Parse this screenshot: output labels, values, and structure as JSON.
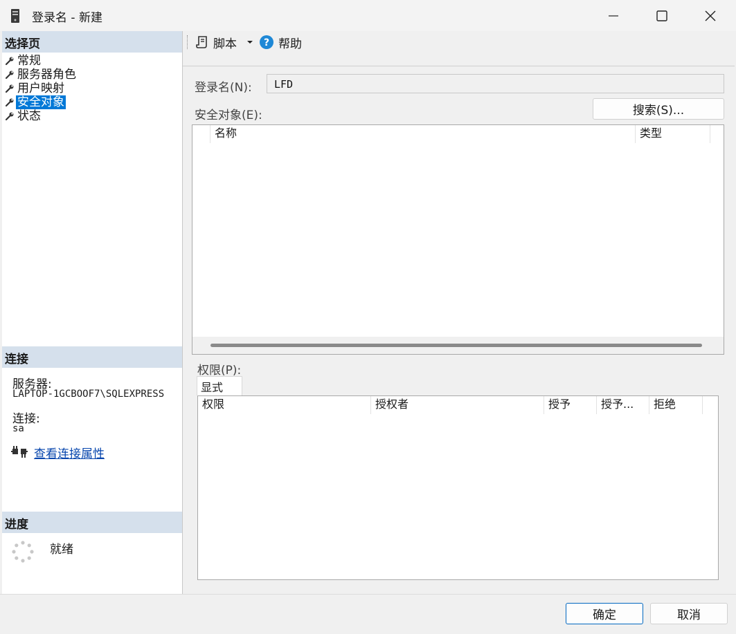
{
  "window": {
    "title": "登录名 - 新建"
  },
  "left": {
    "select_page_header": "选择页",
    "pages": [
      {
        "label": "常规"
      },
      {
        "label": "服务器角色"
      },
      {
        "label": "用户映射"
      },
      {
        "label": "安全对象",
        "selected": true
      },
      {
        "label": "状态"
      }
    ],
    "connection_header": "连接",
    "server_label": "服务器:",
    "server_value": "LAPTOP-1GCBOOF7\\SQLEXPRESS",
    "connection_label": "连接:",
    "connection_value": "sa",
    "view_props_link": "查看连接属性",
    "progress_header": "进度",
    "progress_status": "就绪"
  },
  "toolbar": {
    "script_label": "脚本",
    "help_label": "帮助"
  },
  "form": {
    "login_name_label": "登录名(N):",
    "login_name_value": "LFD",
    "securables_label": "安全对象(E):",
    "search_button": "搜索(S)...",
    "securables_columns": [
      "名称",
      "类型"
    ],
    "permissions_label": "权限(P):",
    "permissions_tab": "显式",
    "permissions_columns": [
      "权限",
      "授权者",
      "授予",
      "授予...",
      "拒绝"
    ]
  },
  "footer": {
    "ok_button": "确定",
    "cancel_button": "取消"
  },
  "colors": {
    "selection": "#0078d7",
    "section_header": "#d5e0ec",
    "primary_border": "#0067c0",
    "link": "#0645ad"
  }
}
